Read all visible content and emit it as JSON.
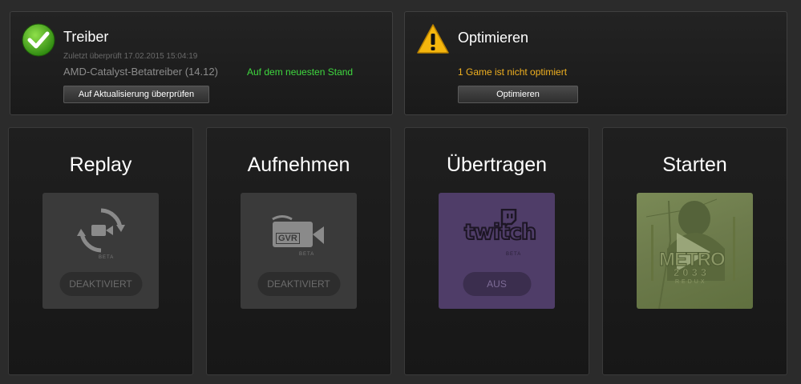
{
  "driver": {
    "title": "Treiber",
    "last_checked": "Zuletzt überprüft 17.02.2015 15:04:19",
    "driver_name": "AMD-Catalyst-Betatreiber (14.12)",
    "status": "Auf dem neuesten Stand",
    "check_button": "Auf Aktualisierung überprüfen",
    "status_color": "#3fd83f"
  },
  "optimize": {
    "title": "Optimieren",
    "message": "1 Game ist nicht optimiert",
    "button": "Optimieren",
    "message_color": "#f0b020"
  },
  "cards": [
    {
      "title": "Replay",
      "icon": "replay-icon",
      "badge": "BETA",
      "toggle": "DEAKTIVIERT"
    },
    {
      "title": "Aufnehmen",
      "icon": "gvr-camera-icon",
      "icon_text": "GVR",
      "badge": "BETA",
      "toggle": "DEAKTIVIERT"
    },
    {
      "title": "Übertragen",
      "icon": "twitch-logo",
      "logo_text": "twitch",
      "badge": "BETA",
      "toggle": "AUS"
    },
    {
      "title": "Starten",
      "icon": "play-icon",
      "game_title": "METRO",
      "game_subtitle": "2033",
      "game_edition": "REDUX"
    }
  ]
}
